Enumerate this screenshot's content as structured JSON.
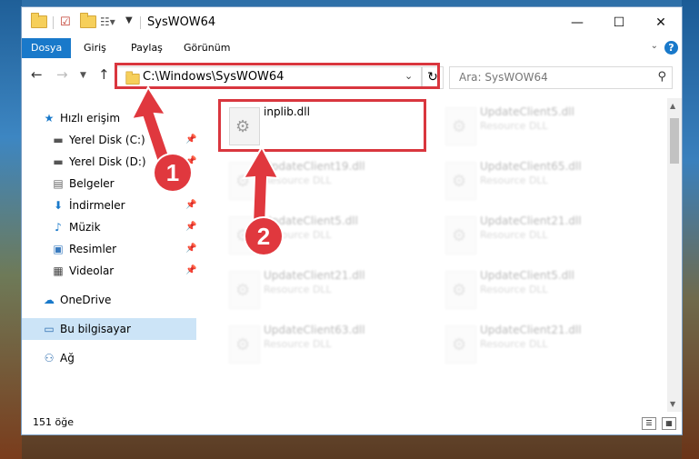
{
  "window": {
    "title": "SysWOW64",
    "controls": {
      "minimize": "—",
      "maximize": "☐",
      "close": "✕"
    }
  },
  "ribbon": {
    "tabs": [
      {
        "label": "Dosya",
        "active": true
      },
      {
        "label": "Giriş"
      },
      {
        "label": "Paylaş"
      },
      {
        "label": "Görünüm"
      }
    ],
    "help": "?"
  },
  "address": {
    "path": "C:\\Windows\\SysWOW64",
    "search_placeholder": "Ara: SysWOW64"
  },
  "nav": {
    "items": [
      {
        "label": "Hızlı erişim",
        "icon": "star-icon",
        "glyph": "★"
      },
      {
        "label": "Yerel Disk (C:)",
        "icon": "drive-icon",
        "glyph": "▬",
        "pinned": true
      },
      {
        "label": "Yerel Disk (D:)",
        "icon": "drive-icon",
        "glyph": "▬",
        "pinned": true
      },
      {
        "label": "Belgeler",
        "icon": "documents-icon",
        "glyph": "▤",
        "pinned": true
      },
      {
        "label": "İndirmeler",
        "icon": "download-icon",
        "glyph": "⬇",
        "pinned": true
      },
      {
        "label": "Müzik",
        "icon": "music-icon",
        "glyph": "♪",
        "pinned": true
      },
      {
        "label": "Resimler",
        "icon": "pictures-icon",
        "glyph": "▣",
        "pinned": true
      },
      {
        "label": "Videolar",
        "icon": "videos-icon",
        "glyph": "▦",
        "pinned": true
      },
      {
        "label": "OneDrive",
        "icon": "cloud-icon",
        "glyph": "☁"
      },
      {
        "label": "Bu bilgisayar",
        "icon": "computer-icon",
        "glyph": "▭",
        "selected": true
      },
      {
        "label": "Ağ",
        "icon": "network-icon",
        "glyph": "⚇"
      }
    ],
    "pin_glyph": "📌"
  },
  "files": [
    {
      "name": "inplib.dll",
      "type": "",
      "highlight": true
    },
    {
      "name": "UpdateClient5.dll",
      "type": "Resource DLL"
    },
    {
      "name": "UpdateClient19.dll",
      "type": "Resource DLL"
    },
    {
      "name": "UpdateClient65.dll",
      "type": "Resource DLL"
    },
    {
      "name": "UpdateClient5.dll",
      "type": "Resource DLL"
    },
    {
      "name": "UpdateClient21.dll",
      "type": "Resource DLL"
    },
    {
      "name": "UpdateClient21.dll",
      "type": "Resource DLL"
    },
    {
      "name": "UpdateClient5.dll",
      "type": "Resource DLL"
    },
    {
      "name": "UpdateClient63.dll",
      "type": "Resource DLL"
    },
    {
      "name": "UpdateClient21.dll",
      "type": "Resource DLL"
    }
  ],
  "status": {
    "count": "151 öğe"
  },
  "callouts": {
    "one": "1",
    "two": "2"
  },
  "colors": {
    "accent": "#1979ca",
    "highlight": "#d9363e",
    "selected": "#cce4f7"
  }
}
